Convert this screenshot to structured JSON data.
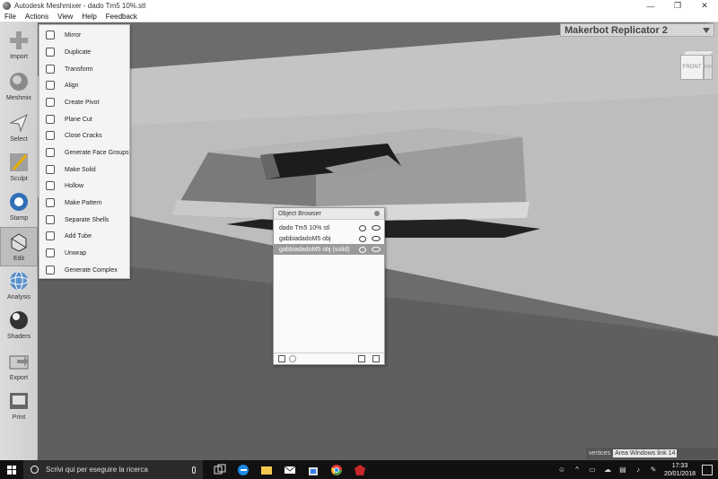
{
  "window": {
    "title": "Autodesk Meshmixer - dado Tm5 10%.stl",
    "controls": [
      "—",
      "❐",
      "✕"
    ]
  },
  "menubar": {
    "items": [
      "File",
      "Actions",
      "View",
      "Help",
      "Feedback"
    ]
  },
  "toolbar": {
    "tools": [
      {
        "id": "import",
        "label": "Import",
        "icon": "plus-icon"
      },
      {
        "id": "meshmix",
        "label": "Meshmix",
        "icon": "meshmix-sphere-icon"
      },
      {
        "id": "select",
        "label": "Select",
        "icon": "arrow-pointer-icon"
      },
      {
        "id": "sculpt",
        "label": "Sculpt",
        "icon": "brush-icon"
      },
      {
        "id": "stamp",
        "label": "Stamp",
        "icon": "stamp-splash-icon"
      },
      {
        "id": "edit",
        "label": "Edit",
        "icon": "edit-cube-icon"
      },
      {
        "id": "analysis",
        "label": "Analysis",
        "icon": "analysis-globe-icon"
      },
      {
        "id": "shaders",
        "label": "Shaders",
        "icon": "shader-sphere-icon"
      },
      {
        "id": "export",
        "label": "Export",
        "icon": "export-arrow-icon"
      },
      {
        "id": "print",
        "label": "Print",
        "icon": "printer-icon"
      }
    ],
    "active": "edit"
  },
  "edit_menu": {
    "items": [
      {
        "label": "Mirror",
        "icon": "mirror-icon"
      },
      {
        "label": "Duplicate",
        "icon": "duplicate-icon"
      },
      {
        "label": "Transform",
        "icon": "transform-icon"
      },
      {
        "label": "Align",
        "icon": "align-icon"
      },
      {
        "label": "Create Pivot",
        "icon": "pivot-icon"
      },
      {
        "label": "Plane Cut",
        "icon": "plane-cut-icon"
      },
      {
        "label": "Close Cracks",
        "icon": "close-cracks-icon"
      },
      {
        "label": "Generate Face Groups",
        "icon": "face-groups-icon"
      },
      {
        "label": "Make Solid",
        "icon": "make-solid-icon"
      },
      {
        "label": "Hollow",
        "icon": "hollow-icon"
      },
      {
        "label": "Make Pattern",
        "icon": "pattern-icon"
      },
      {
        "label": "Separate Shells",
        "icon": "separate-shells-icon"
      },
      {
        "label": "Add Tube",
        "icon": "tube-icon"
      },
      {
        "label": "Unwrap",
        "icon": "unwrap-icon"
      },
      {
        "label": "Generate Complex",
        "icon": "complex-icon"
      }
    ]
  },
  "viewport": {
    "printer": "Makerbot Replicator 2",
    "viewcube": {
      "front": "FRONT",
      "right": "RIGHT"
    },
    "status_label": "vertices",
    "status_overlay": "Area Windows link 14"
  },
  "object_browser": {
    "title": "Object Browser",
    "objects": [
      {
        "name": "dado Tm5 10% stl",
        "selected": false
      },
      {
        "name": "gabbiadadoM5 obj",
        "selected": false
      },
      {
        "name": "gabbiadadoM5 obj (solid)",
        "selected": true
      }
    ]
  },
  "taskbar": {
    "search_placeholder": "Scrivi qui per eseguire la ricerca",
    "apps": [
      "task-view-icon",
      "edge-icon",
      "file-explorer-icon",
      "mail-icon",
      "store-icon",
      "chrome-icon",
      "meshmixer-icon"
    ],
    "time": "17:33",
    "date": "20/01/2018"
  },
  "colors": {
    "background": "#6f6f6f",
    "panel": "#f4f4f4",
    "selected_row": "#9a9a9a"
  }
}
